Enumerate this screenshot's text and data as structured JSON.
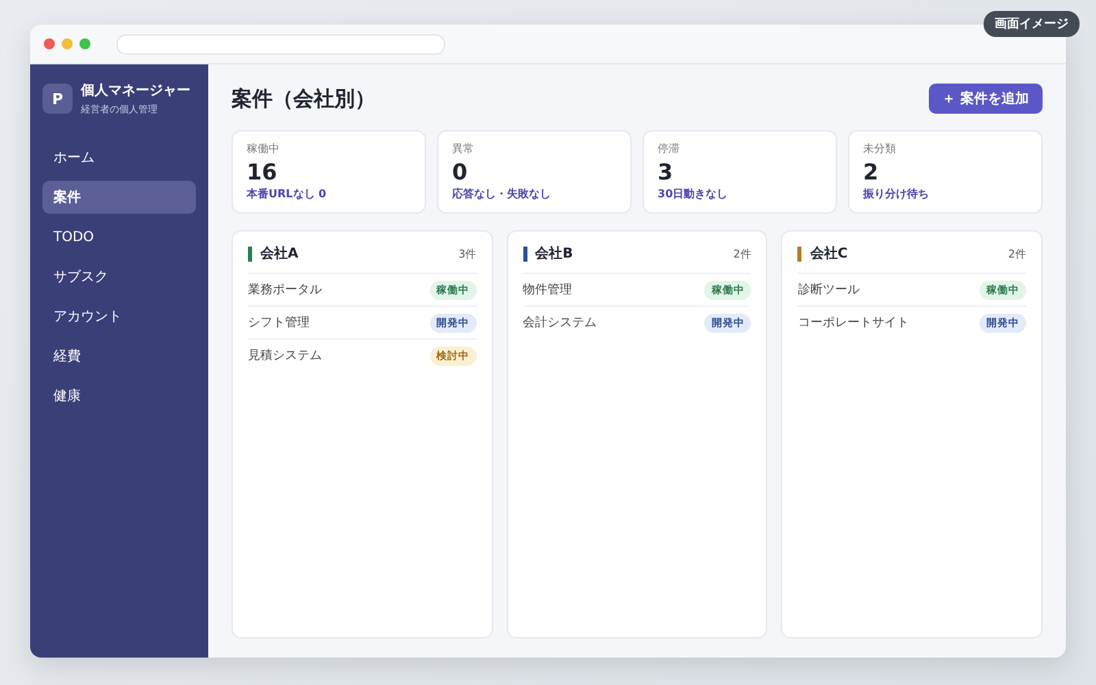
{
  "badge": "画面イメージ",
  "sidebar": {
    "logo": "P",
    "title": "個人マネージャー",
    "subtitle": "経営者の個人管理",
    "items": [
      {
        "label": "ホーム",
        "selected": false
      },
      {
        "label": "案件",
        "selected": true
      },
      {
        "label": "TODO",
        "selected": false
      },
      {
        "label": "サブスク",
        "selected": false
      },
      {
        "label": "アカウント",
        "selected": false
      },
      {
        "label": "経費",
        "selected": false
      },
      {
        "label": "健康",
        "selected": false
      }
    ]
  },
  "header": {
    "title": "案件（会社別）",
    "add_button": "＋ 案件を追加"
  },
  "stats": [
    {
      "label": "稼働中",
      "value": "16",
      "note": "本番URLなし 0"
    },
    {
      "label": "異常",
      "value": "0",
      "note": "応答なし・失敗なし"
    },
    {
      "label": "停滞",
      "value": "3",
      "note": "30日動きなし"
    },
    {
      "label": "未分類",
      "value": "2",
      "note": "振り分け待ち"
    }
  ],
  "companies": [
    {
      "name": "会社A",
      "color": "#2e7d4f",
      "count": "3件",
      "projects": [
        {
          "name": "業務ポータル",
          "status": "稼働中",
          "kind": "active"
        },
        {
          "name": "シフト管理",
          "status": "開発中",
          "kind": "dev"
        },
        {
          "name": "見積システム",
          "status": "検討中",
          "kind": "review"
        }
      ]
    },
    {
      "name": "会社B",
      "color": "#2f4f8f",
      "count": "2件",
      "projects": [
        {
          "name": "物件管理",
          "status": "稼働中",
          "kind": "active"
        },
        {
          "name": "会計システム",
          "status": "開発中",
          "kind": "dev"
        }
      ]
    },
    {
      "name": "会社C",
      "color": "#b87a2a",
      "count": "2件",
      "projects": [
        {
          "name": "診断ツール",
          "status": "稼働中",
          "kind": "active"
        },
        {
          "name": "コーポレートサイト",
          "status": "開発中",
          "kind": "dev"
        }
      ]
    }
  ]
}
